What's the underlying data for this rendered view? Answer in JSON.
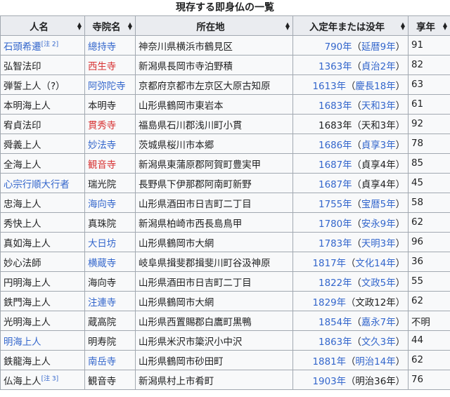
{
  "caption": "現存する即身仏の一覧",
  "columns": [
    "人名",
    "寺院名",
    "所在地",
    "入定年または没年",
    "享年"
  ],
  "rows": [
    {
      "name": "石頭希遷",
      "name_style": "link",
      "note": "[注 2]",
      "temple": "總持寺",
      "temple_style": "link",
      "place": "神奈川県横浜市鶴見区",
      "year": "790年",
      "year_style": "link",
      "era": "延暦9年",
      "era_style": "link",
      "age": "91"
    },
    {
      "name": "弘智法印",
      "name_style": "plain",
      "note": "",
      "temple": "西生寺",
      "temple_style": "red",
      "place": "新潟県長岡市寺泊野積",
      "year": "1363年",
      "year_style": "link",
      "era": "貞治2年",
      "era_style": "link",
      "age": "82"
    },
    {
      "name": "弾誓上人（?）",
      "name_style": "plain",
      "note": "",
      "temple": "阿弥陀寺",
      "temple_style": "link",
      "place": "京都府京都市左京区大原古知原",
      "year": "1613年",
      "year_style": "link",
      "era": "慶長18年",
      "era_style": "link",
      "age": "63"
    },
    {
      "name": "本明海上人",
      "name_style": "plain",
      "note": "",
      "temple": "本明寺",
      "temple_style": "plain",
      "place": "山形県鶴岡市東岩本",
      "year": "1683年",
      "year_style": "link",
      "era": "天和3年",
      "era_style": "link",
      "age": "61"
    },
    {
      "name": "宥貞法印",
      "name_style": "plain",
      "note": "",
      "temple": "貫秀寺",
      "temple_style": "red",
      "place": "福島県石川郡浅川町小貫",
      "year": "1683年",
      "year_style": "plain",
      "era": "天和3年",
      "era_style": "plain",
      "age": "92"
    },
    {
      "name": "舜義上人",
      "name_style": "plain",
      "note": "",
      "temple": "妙法寺",
      "temple_style": "link",
      "place": "茨城県桜川市本郷",
      "year": "1686年",
      "year_style": "link",
      "era": "貞享3年",
      "era_style": "link",
      "age": "78"
    },
    {
      "name": "全海上人",
      "name_style": "plain",
      "note": "",
      "temple": "観音寺",
      "temple_style": "red",
      "place": "新潟県東蒲原郡阿賀町豊実甲",
      "year": "1687年",
      "year_style": "link",
      "era": "貞享4年",
      "era_style": "plain",
      "age": "85"
    },
    {
      "name": "心宗行順大行者",
      "name_style": "link",
      "note": "",
      "temple": "瑞光院",
      "temple_style": "plain",
      "place": "長野県下伊那郡阿南町新野",
      "year": "1687年",
      "year_style": "link",
      "era": "貞享4年",
      "era_style": "plain",
      "age": "45"
    },
    {
      "name": "忠海上人",
      "name_style": "plain",
      "note": "",
      "temple": "海向寺",
      "temple_style": "link",
      "place": "山形県酒田市日吉町二丁目",
      "year": "1755年",
      "year_style": "link",
      "era": "宝暦5年",
      "era_style": "link",
      "age": "58"
    },
    {
      "name": "秀快上人",
      "name_style": "plain",
      "note": "",
      "temple": "真珠院",
      "temple_style": "plain",
      "place": "新潟県柏崎市西長島鳥甲",
      "year": "1780年",
      "year_style": "link",
      "era": "安永9年",
      "era_style": "link",
      "age": "62"
    },
    {
      "name": "真如海上人",
      "name_style": "plain",
      "note": "",
      "temple": "大日坊",
      "temple_style": "link",
      "place": "山形県鶴岡市大網",
      "year": "1783年",
      "year_style": "link",
      "era": "天明3年",
      "era_style": "link",
      "age": "96"
    },
    {
      "name": "妙心法師",
      "name_style": "plain",
      "note": "",
      "temple": "横蔵寺",
      "temple_style": "link",
      "place": "岐阜県揖斐郡揖斐川町谷汲神原",
      "year": "1817年",
      "year_style": "link",
      "era": "文化14年",
      "era_style": "link",
      "age": "36"
    },
    {
      "name": "円明海上人",
      "name_style": "plain",
      "note": "",
      "temple": "海向寺",
      "temple_style": "plain",
      "place": "山形県酒田市日吉町二丁目",
      "year": "1822年",
      "year_style": "link",
      "era": "文政5年",
      "era_style": "link",
      "age": "55"
    },
    {
      "name": "鉄門海上人",
      "name_style": "plain",
      "note": "",
      "temple": "注連寺",
      "temple_style": "link",
      "place": "山形県鶴岡市大網",
      "year": "1829年",
      "year_style": "link",
      "era": "文政12年",
      "era_style": "plain",
      "age": "62"
    },
    {
      "name": "光明海上人",
      "name_style": "plain",
      "note": "",
      "temple": "蔵高院",
      "temple_style": "plain",
      "place": "山形県西置賜郡白鷹町黒鴨",
      "year": "1854年",
      "year_style": "link",
      "era": "嘉永7年",
      "era_style": "link",
      "age": "不明"
    },
    {
      "name": "明海上人",
      "name_style": "link",
      "note": "",
      "temple": "明寿院",
      "temple_style": "plain",
      "place": "山形県米沢市簗沢小中沢",
      "year": "1863年",
      "year_style": "link",
      "era": "文久3年",
      "era_style": "link",
      "age": "44"
    },
    {
      "name": "鉄龍海上人",
      "name_style": "plain",
      "note": "",
      "temple": "南岳寺",
      "temple_style": "link",
      "place": "山形県鶴岡市砂田町",
      "year": "1881年",
      "year_style": "link",
      "era": "明治14年",
      "era_style": "link",
      "age": "62"
    },
    {
      "name": "仏海上人",
      "name_style": "plain",
      "note": "[注 3]",
      "temple": "観音寺",
      "temple_style": "plain",
      "place": "新潟県村上市肴町",
      "year": "1903年",
      "year_style": "link",
      "era": "明治36年",
      "era_style": "plain",
      "age": "76"
    }
  ]
}
